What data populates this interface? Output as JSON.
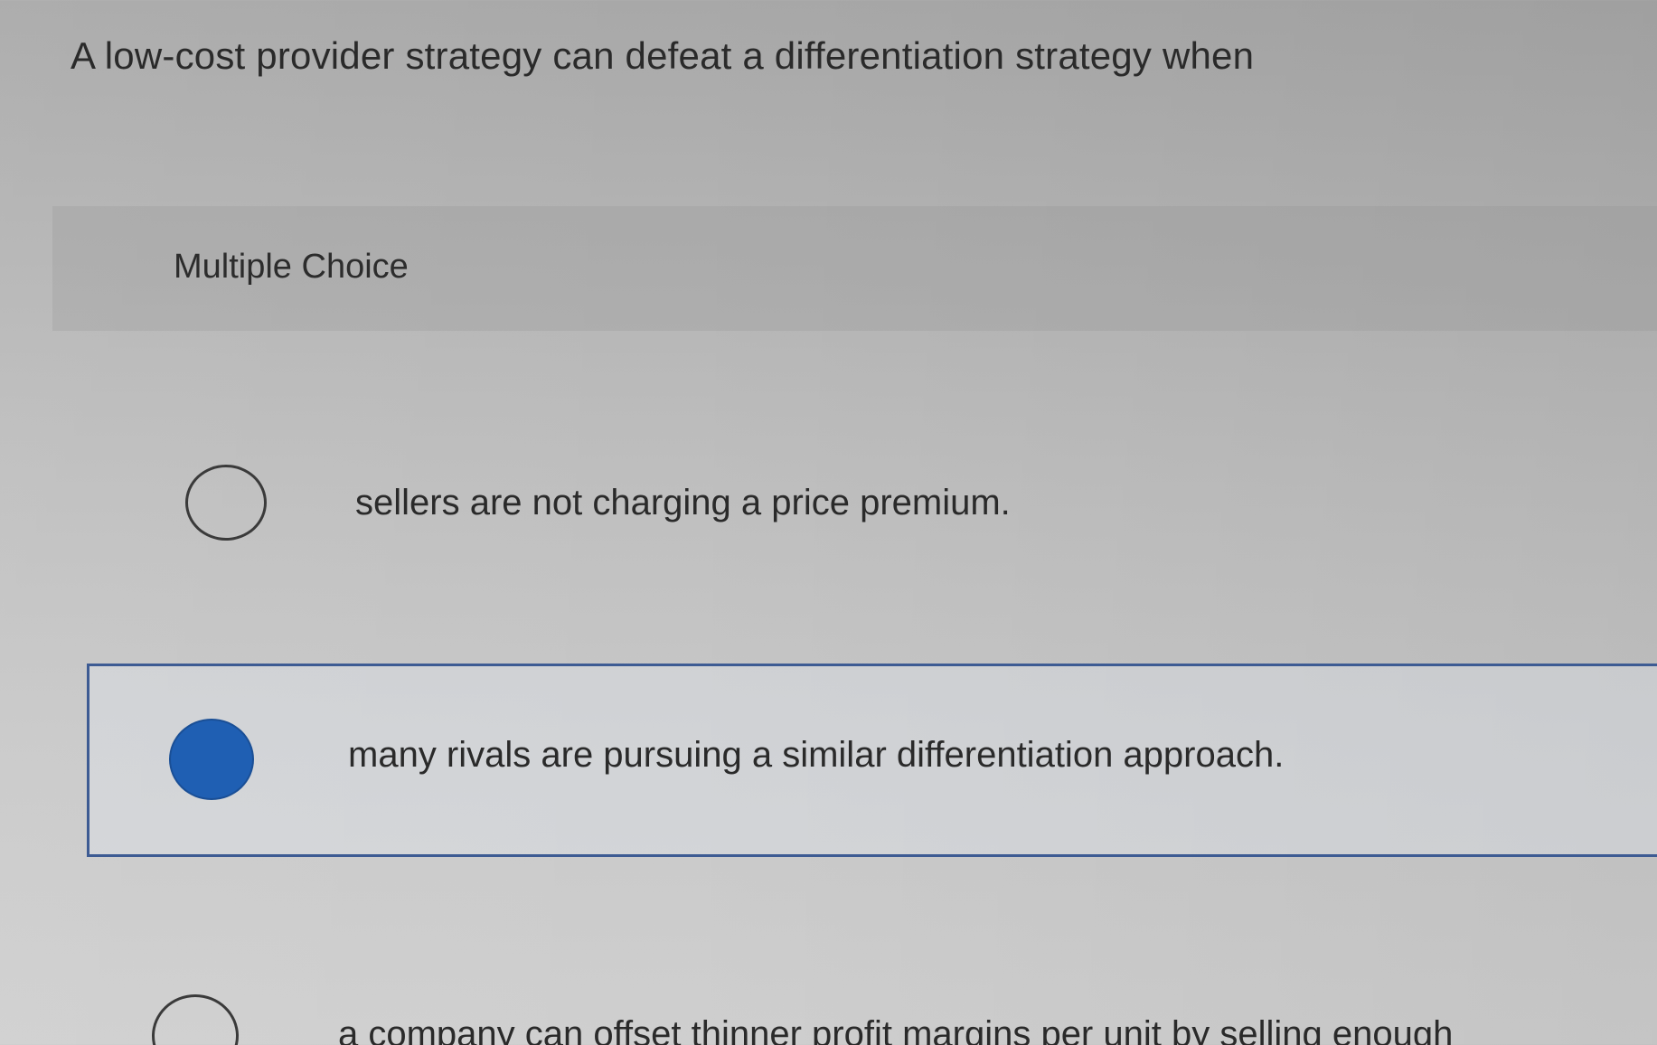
{
  "question": {
    "text": "A low-cost provider strategy can defeat a differentiation strategy when"
  },
  "section": {
    "label": "Multiple Choice"
  },
  "options": [
    {
      "text": "sellers are not charging a price premium.",
      "selected": false
    },
    {
      "text": "many rivals are pursuing a similar differentiation approach.",
      "selected": true
    },
    {
      "text": "a company can offset thinner profit margins per unit by selling enough",
      "selected": false
    }
  ],
  "colors": {
    "selected_fill": "#1f5fb3",
    "selected_border": "#3d5b93"
  }
}
